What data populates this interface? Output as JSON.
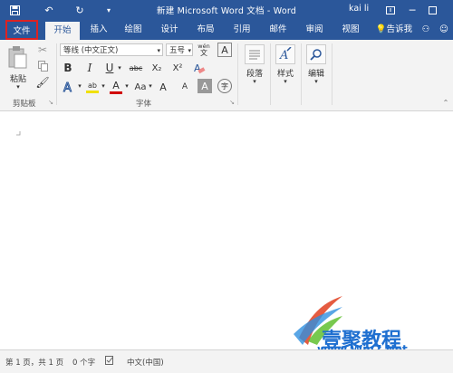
{
  "title": {
    "quick_save_icon": "save-icon",
    "undo_icon": "undo-icon",
    "redo_icon": "redo-icon",
    "text": "新建 Microsoft Word 文档 - Word",
    "user": "kai li"
  },
  "tabs": [
    "文件",
    "开始",
    "插入",
    "绘图",
    "设计",
    "布局",
    "引用",
    "邮件",
    "审阅",
    "视图"
  ],
  "tell_me": "告诉我",
  "ribbon": {
    "clipboard": {
      "paste": "粘贴",
      "label": "剪贴板"
    },
    "font": {
      "name": "等线 (中文正文)",
      "size": "五号",
      "wen": "wén",
      "label": "字体",
      "bold": "B",
      "italic": "I",
      "underline": "U",
      "strike": "abc",
      "sub": "X₂",
      "sup": "X²",
      "aa": "Aa",
      "grow": "A",
      "shrink": "A",
      "phonetic": "字"
    },
    "paragraph": {
      "label": "段落"
    },
    "styles": {
      "label": "样式"
    },
    "editing": {
      "label": "编辑"
    }
  },
  "status": {
    "page": "第 1 页，共 1 页",
    "words": "0 个字",
    "lang": "中文(中国)"
  },
  "watermark": {
    "text1": "壹聚教程",
    "text2": "www.Win7.Net"
  },
  "colors": {
    "brand": "#2b579a",
    "highlight": "#f0e000",
    "font_red": "#d00000"
  }
}
